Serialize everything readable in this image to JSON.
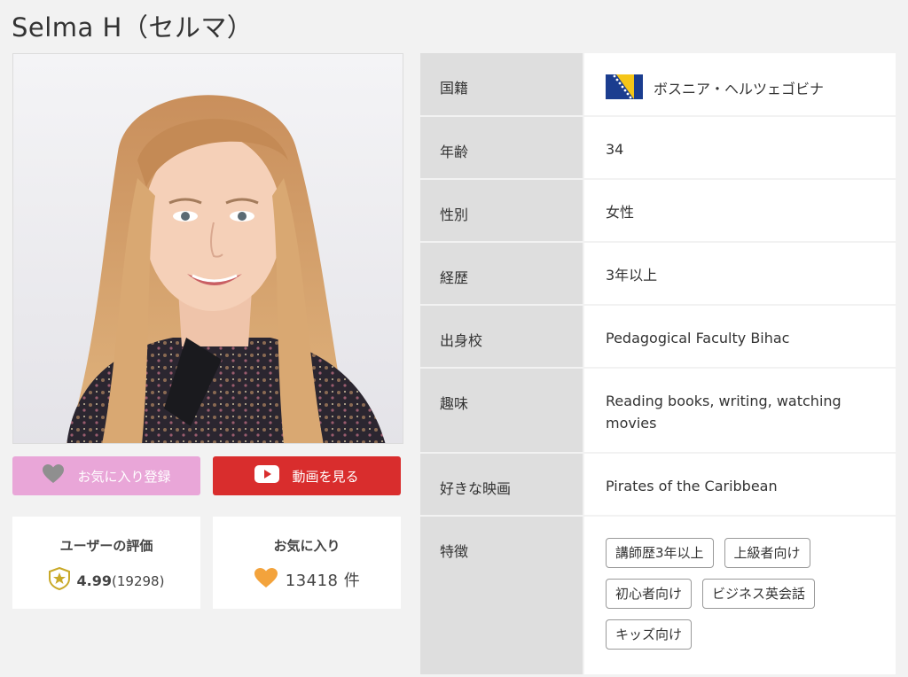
{
  "profile": {
    "name": "Selma H（セルマ）"
  },
  "buttons": {
    "favorite": "お気に入り登録",
    "video": "動画を見る"
  },
  "rating": {
    "title": "ユーザーの評価",
    "score": "4.99",
    "count": "(19298)"
  },
  "favorites": {
    "title": "お気に入り",
    "count": "13418 件"
  },
  "info": [
    {
      "label": "国籍",
      "value": "ボスニア・ヘルツェゴビナ"
    },
    {
      "label": "年齢",
      "value": "34"
    },
    {
      "label": "性別",
      "value": "女性"
    },
    {
      "label": "経歴",
      "value": "3年以上"
    },
    {
      "label": "出身校",
      "value": "Pedagogical Faculty Bihac"
    },
    {
      "label": "趣味",
      "value": "Reading books, writing, watching movies"
    },
    {
      "label": "好きな映画",
      "value": "Pirates of the Caribbean"
    },
    {
      "label": "特徴",
      "value": ""
    }
  ],
  "tags": [
    "講師歴3年以上",
    "上級者向け",
    "初心者向け",
    "ビジネス英会話",
    "キッズ向け"
  ],
  "colors": {
    "favorite_button": "#e9a6d8",
    "video_button": "#d92d2d",
    "heart": "#f3a33c",
    "badge": "#c9a928"
  },
  "icons": {
    "flag": "bosnia-flag-icon",
    "favorite": "heart-icon",
    "video": "play-icon",
    "rating": "shield-star-icon"
  }
}
